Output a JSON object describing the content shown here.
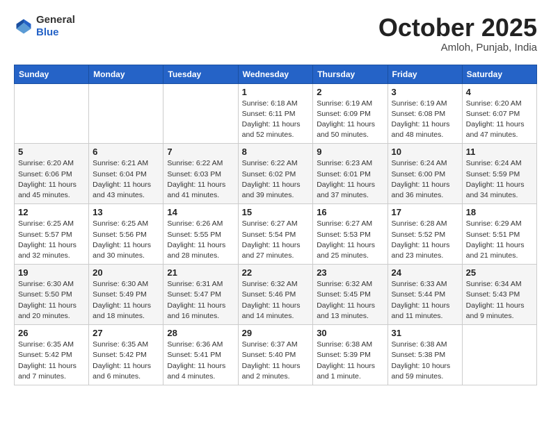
{
  "header": {
    "logo_line1": "General",
    "logo_line2": "Blue",
    "month": "October 2025",
    "location": "Amloh, Punjab, India"
  },
  "days_of_week": [
    "Sunday",
    "Monday",
    "Tuesday",
    "Wednesday",
    "Thursday",
    "Friday",
    "Saturday"
  ],
  "weeks": [
    [
      {
        "day": "",
        "info": ""
      },
      {
        "day": "",
        "info": ""
      },
      {
        "day": "",
        "info": ""
      },
      {
        "day": "1",
        "info": "Sunrise: 6:18 AM\nSunset: 6:11 PM\nDaylight: 11 hours\nand 52 minutes."
      },
      {
        "day": "2",
        "info": "Sunrise: 6:19 AM\nSunset: 6:09 PM\nDaylight: 11 hours\nand 50 minutes."
      },
      {
        "day": "3",
        "info": "Sunrise: 6:19 AM\nSunset: 6:08 PM\nDaylight: 11 hours\nand 48 minutes."
      },
      {
        "day": "4",
        "info": "Sunrise: 6:20 AM\nSunset: 6:07 PM\nDaylight: 11 hours\nand 47 minutes."
      }
    ],
    [
      {
        "day": "5",
        "info": "Sunrise: 6:20 AM\nSunset: 6:06 PM\nDaylight: 11 hours\nand 45 minutes."
      },
      {
        "day": "6",
        "info": "Sunrise: 6:21 AM\nSunset: 6:04 PM\nDaylight: 11 hours\nand 43 minutes."
      },
      {
        "day": "7",
        "info": "Sunrise: 6:22 AM\nSunset: 6:03 PM\nDaylight: 11 hours\nand 41 minutes."
      },
      {
        "day": "8",
        "info": "Sunrise: 6:22 AM\nSunset: 6:02 PM\nDaylight: 11 hours\nand 39 minutes."
      },
      {
        "day": "9",
        "info": "Sunrise: 6:23 AM\nSunset: 6:01 PM\nDaylight: 11 hours\nand 37 minutes."
      },
      {
        "day": "10",
        "info": "Sunrise: 6:24 AM\nSunset: 6:00 PM\nDaylight: 11 hours\nand 36 minutes."
      },
      {
        "day": "11",
        "info": "Sunrise: 6:24 AM\nSunset: 5:59 PM\nDaylight: 11 hours\nand 34 minutes."
      }
    ],
    [
      {
        "day": "12",
        "info": "Sunrise: 6:25 AM\nSunset: 5:57 PM\nDaylight: 11 hours\nand 32 minutes."
      },
      {
        "day": "13",
        "info": "Sunrise: 6:25 AM\nSunset: 5:56 PM\nDaylight: 11 hours\nand 30 minutes."
      },
      {
        "day": "14",
        "info": "Sunrise: 6:26 AM\nSunset: 5:55 PM\nDaylight: 11 hours\nand 28 minutes."
      },
      {
        "day": "15",
        "info": "Sunrise: 6:27 AM\nSunset: 5:54 PM\nDaylight: 11 hours\nand 27 minutes."
      },
      {
        "day": "16",
        "info": "Sunrise: 6:27 AM\nSunset: 5:53 PM\nDaylight: 11 hours\nand 25 minutes."
      },
      {
        "day": "17",
        "info": "Sunrise: 6:28 AM\nSunset: 5:52 PM\nDaylight: 11 hours\nand 23 minutes."
      },
      {
        "day": "18",
        "info": "Sunrise: 6:29 AM\nSunset: 5:51 PM\nDaylight: 11 hours\nand 21 minutes."
      }
    ],
    [
      {
        "day": "19",
        "info": "Sunrise: 6:30 AM\nSunset: 5:50 PM\nDaylight: 11 hours\nand 20 minutes."
      },
      {
        "day": "20",
        "info": "Sunrise: 6:30 AM\nSunset: 5:49 PM\nDaylight: 11 hours\nand 18 minutes."
      },
      {
        "day": "21",
        "info": "Sunrise: 6:31 AM\nSunset: 5:47 PM\nDaylight: 11 hours\nand 16 minutes."
      },
      {
        "day": "22",
        "info": "Sunrise: 6:32 AM\nSunset: 5:46 PM\nDaylight: 11 hours\nand 14 minutes."
      },
      {
        "day": "23",
        "info": "Sunrise: 6:32 AM\nSunset: 5:45 PM\nDaylight: 11 hours\nand 13 minutes."
      },
      {
        "day": "24",
        "info": "Sunrise: 6:33 AM\nSunset: 5:44 PM\nDaylight: 11 hours\nand 11 minutes."
      },
      {
        "day": "25",
        "info": "Sunrise: 6:34 AM\nSunset: 5:43 PM\nDaylight: 11 hours\nand 9 minutes."
      }
    ],
    [
      {
        "day": "26",
        "info": "Sunrise: 6:35 AM\nSunset: 5:42 PM\nDaylight: 11 hours\nand 7 minutes."
      },
      {
        "day": "27",
        "info": "Sunrise: 6:35 AM\nSunset: 5:42 PM\nDaylight: 11 hours\nand 6 minutes."
      },
      {
        "day": "28",
        "info": "Sunrise: 6:36 AM\nSunset: 5:41 PM\nDaylight: 11 hours\nand 4 minutes."
      },
      {
        "day": "29",
        "info": "Sunrise: 6:37 AM\nSunset: 5:40 PM\nDaylight: 11 hours\nand 2 minutes."
      },
      {
        "day": "30",
        "info": "Sunrise: 6:38 AM\nSunset: 5:39 PM\nDaylight: 11 hours\nand 1 minute."
      },
      {
        "day": "31",
        "info": "Sunrise: 6:38 AM\nSunset: 5:38 PM\nDaylight: 10 hours\nand 59 minutes."
      },
      {
        "day": "",
        "info": ""
      }
    ]
  ]
}
